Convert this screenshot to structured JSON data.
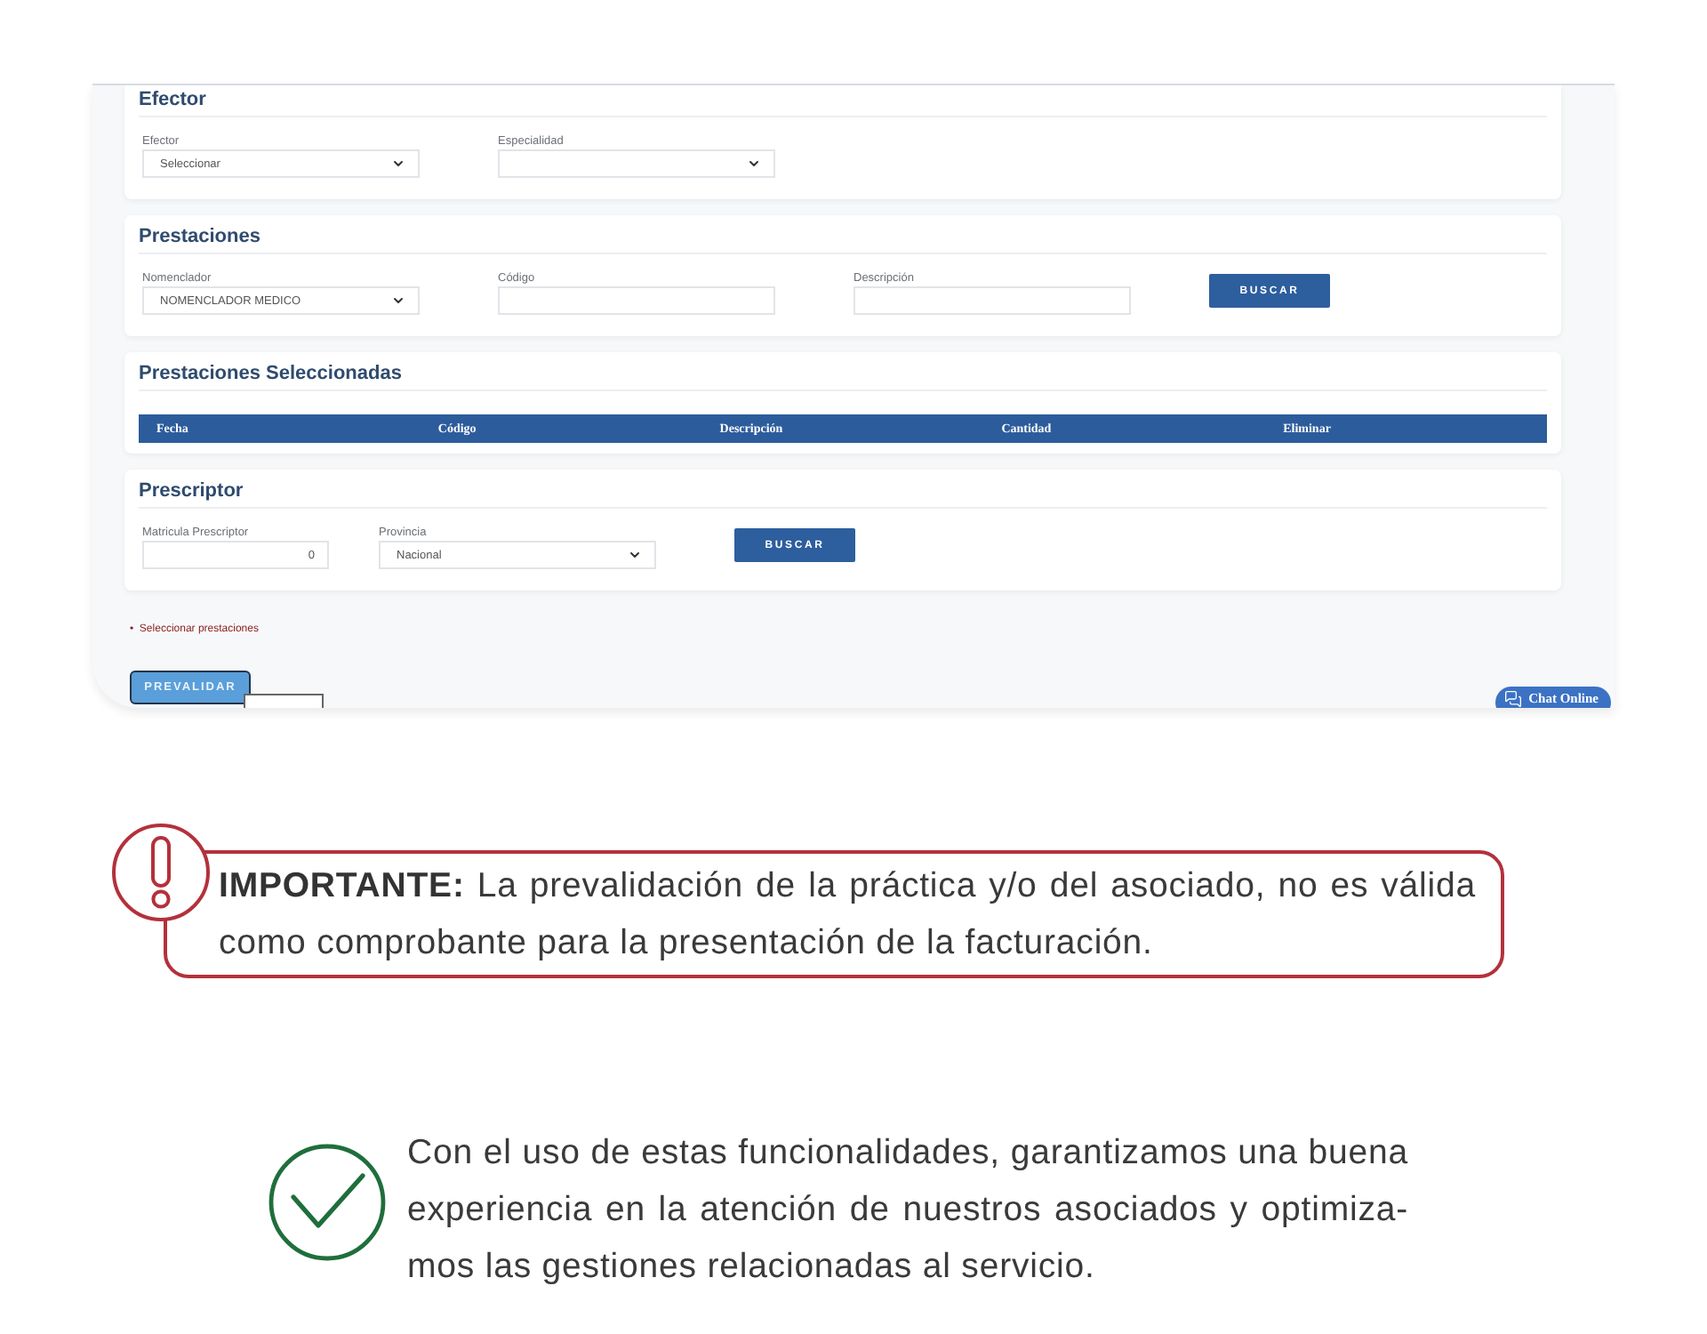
{
  "screenshot": {
    "sections": [
      {
        "kind": "form",
        "title": "Efector",
        "fields": [
          {
            "kind": "select",
            "label": "Efector",
            "value": "Seleccionar"
          },
          {
            "kind": "select",
            "label": "Especialidad"
          }
        ]
      },
      {
        "kind": "form",
        "title": "Prestaciones",
        "fields": [
          {
            "kind": "select",
            "label": "Nomenclador",
            "value": "NOMENCLADOR MEDICO"
          },
          {
            "kind": "input",
            "label": "Código"
          },
          {
            "kind": "input",
            "label": "Descripción"
          }
        ],
        "button": "BUSCAR"
      },
      {
        "kind": "table",
        "title": "Prestaciones Seleccionadas",
        "columns": [
          "Fecha",
          "Código",
          "Descripción",
          "Cantidad",
          "Eliminar"
        ]
      },
      {
        "kind": "form",
        "title": "Prescriptor",
        "fields": [
          {
            "kind": "number",
            "label": "Matricula Prescriptor",
            "value": "0"
          },
          {
            "kind": "select",
            "label": "Provincia",
            "value": "Nacional"
          }
        ],
        "button": "BUSCAR"
      }
    ],
    "validation_message": "•  Seleccionar prestaciones",
    "prevalidar_button": "PREVALIDAR",
    "chat_button": "Chat Online"
  },
  "important_note": {
    "lines": [
      "**IMPORTANTE:** La prevalidación de la práctica y/o del asociado, no es válida",
      "como comprobante para la presentación de la facturación."
    ]
  },
  "closing_note": {
    "lines": [
      "Con el uso de estas funcionalidades, garantizamos una buena",
      "experiencia en la atención de nuestros asociados y optimiza-",
      "mos las gestiones relacionadas al servicio."
    ]
  }
}
